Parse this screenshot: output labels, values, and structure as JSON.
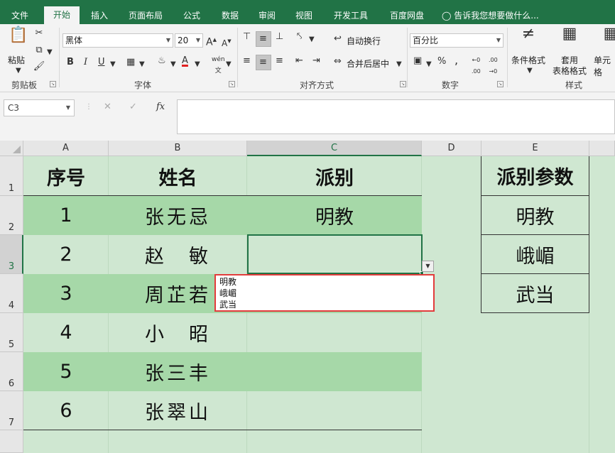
{
  "menu": {
    "tabs": [
      "文件",
      "开始",
      "插入",
      "页面布局",
      "公式",
      "数据",
      "审阅",
      "视图",
      "开发工具",
      "百度网盘"
    ],
    "active_tab": "开始",
    "tell_me": "告诉我您想要做什么..."
  },
  "ribbon": {
    "clipboard": {
      "label": "剪贴板",
      "paste": "粘贴"
    },
    "font": {
      "label": "字体",
      "font_name": "黑体",
      "font_size": "20",
      "bold": "B",
      "italic": "I",
      "underline": "U",
      "grow": "A",
      "shrink": "A",
      "pinyin": "wén",
      "font_color": "#e02020"
    },
    "alignment": {
      "label": "对齐方式",
      "wrap_text": "自动换行",
      "merge_center": "合并后居中"
    },
    "number": {
      "label": "数字",
      "format": "百分比",
      "percent": "%"
    },
    "styles": {
      "label": "样式",
      "conditional_line1": "条件格式",
      "table_line1": "套用",
      "table_line2": "表格格式",
      "cell_styles": "单元格"
    }
  },
  "formula_bar": {
    "name_box": "C3",
    "fx": "fx",
    "value": ""
  },
  "columns": [
    "A",
    "B",
    "C",
    "D",
    "E"
  ],
  "rows": [
    "1",
    "2",
    "3",
    "4",
    "5",
    "6",
    "7"
  ],
  "selected_cell": {
    "column": "C",
    "row": "3"
  },
  "table": {
    "headers": {
      "a": "序号",
      "b": "姓名",
      "c": "派别"
    },
    "rows": [
      {
        "a": "1",
        "b": "张无忌",
        "c": "明教"
      },
      {
        "a": "2",
        "b": "赵　敏",
        "c": ""
      },
      {
        "a": "3",
        "b": "周芷若",
        "c": ""
      },
      {
        "a": "4",
        "b": "小　昭",
        "c": ""
      },
      {
        "a": "5",
        "b": "张三丰",
        "c": ""
      },
      {
        "a": "6",
        "b": "张翠山",
        "c": ""
      }
    ]
  },
  "param_table": {
    "header": "派别参数",
    "items": [
      "明教",
      "峨嵋",
      "武当"
    ]
  },
  "validation_dropdown": {
    "options": [
      "明教",
      "峨嵋",
      "武当"
    ]
  },
  "colors": {
    "accent": "#217346",
    "grid_fill": "#cfe7d1",
    "band_fill": "#a6d8a8",
    "dropdown_border": "#e23c3c"
  }
}
